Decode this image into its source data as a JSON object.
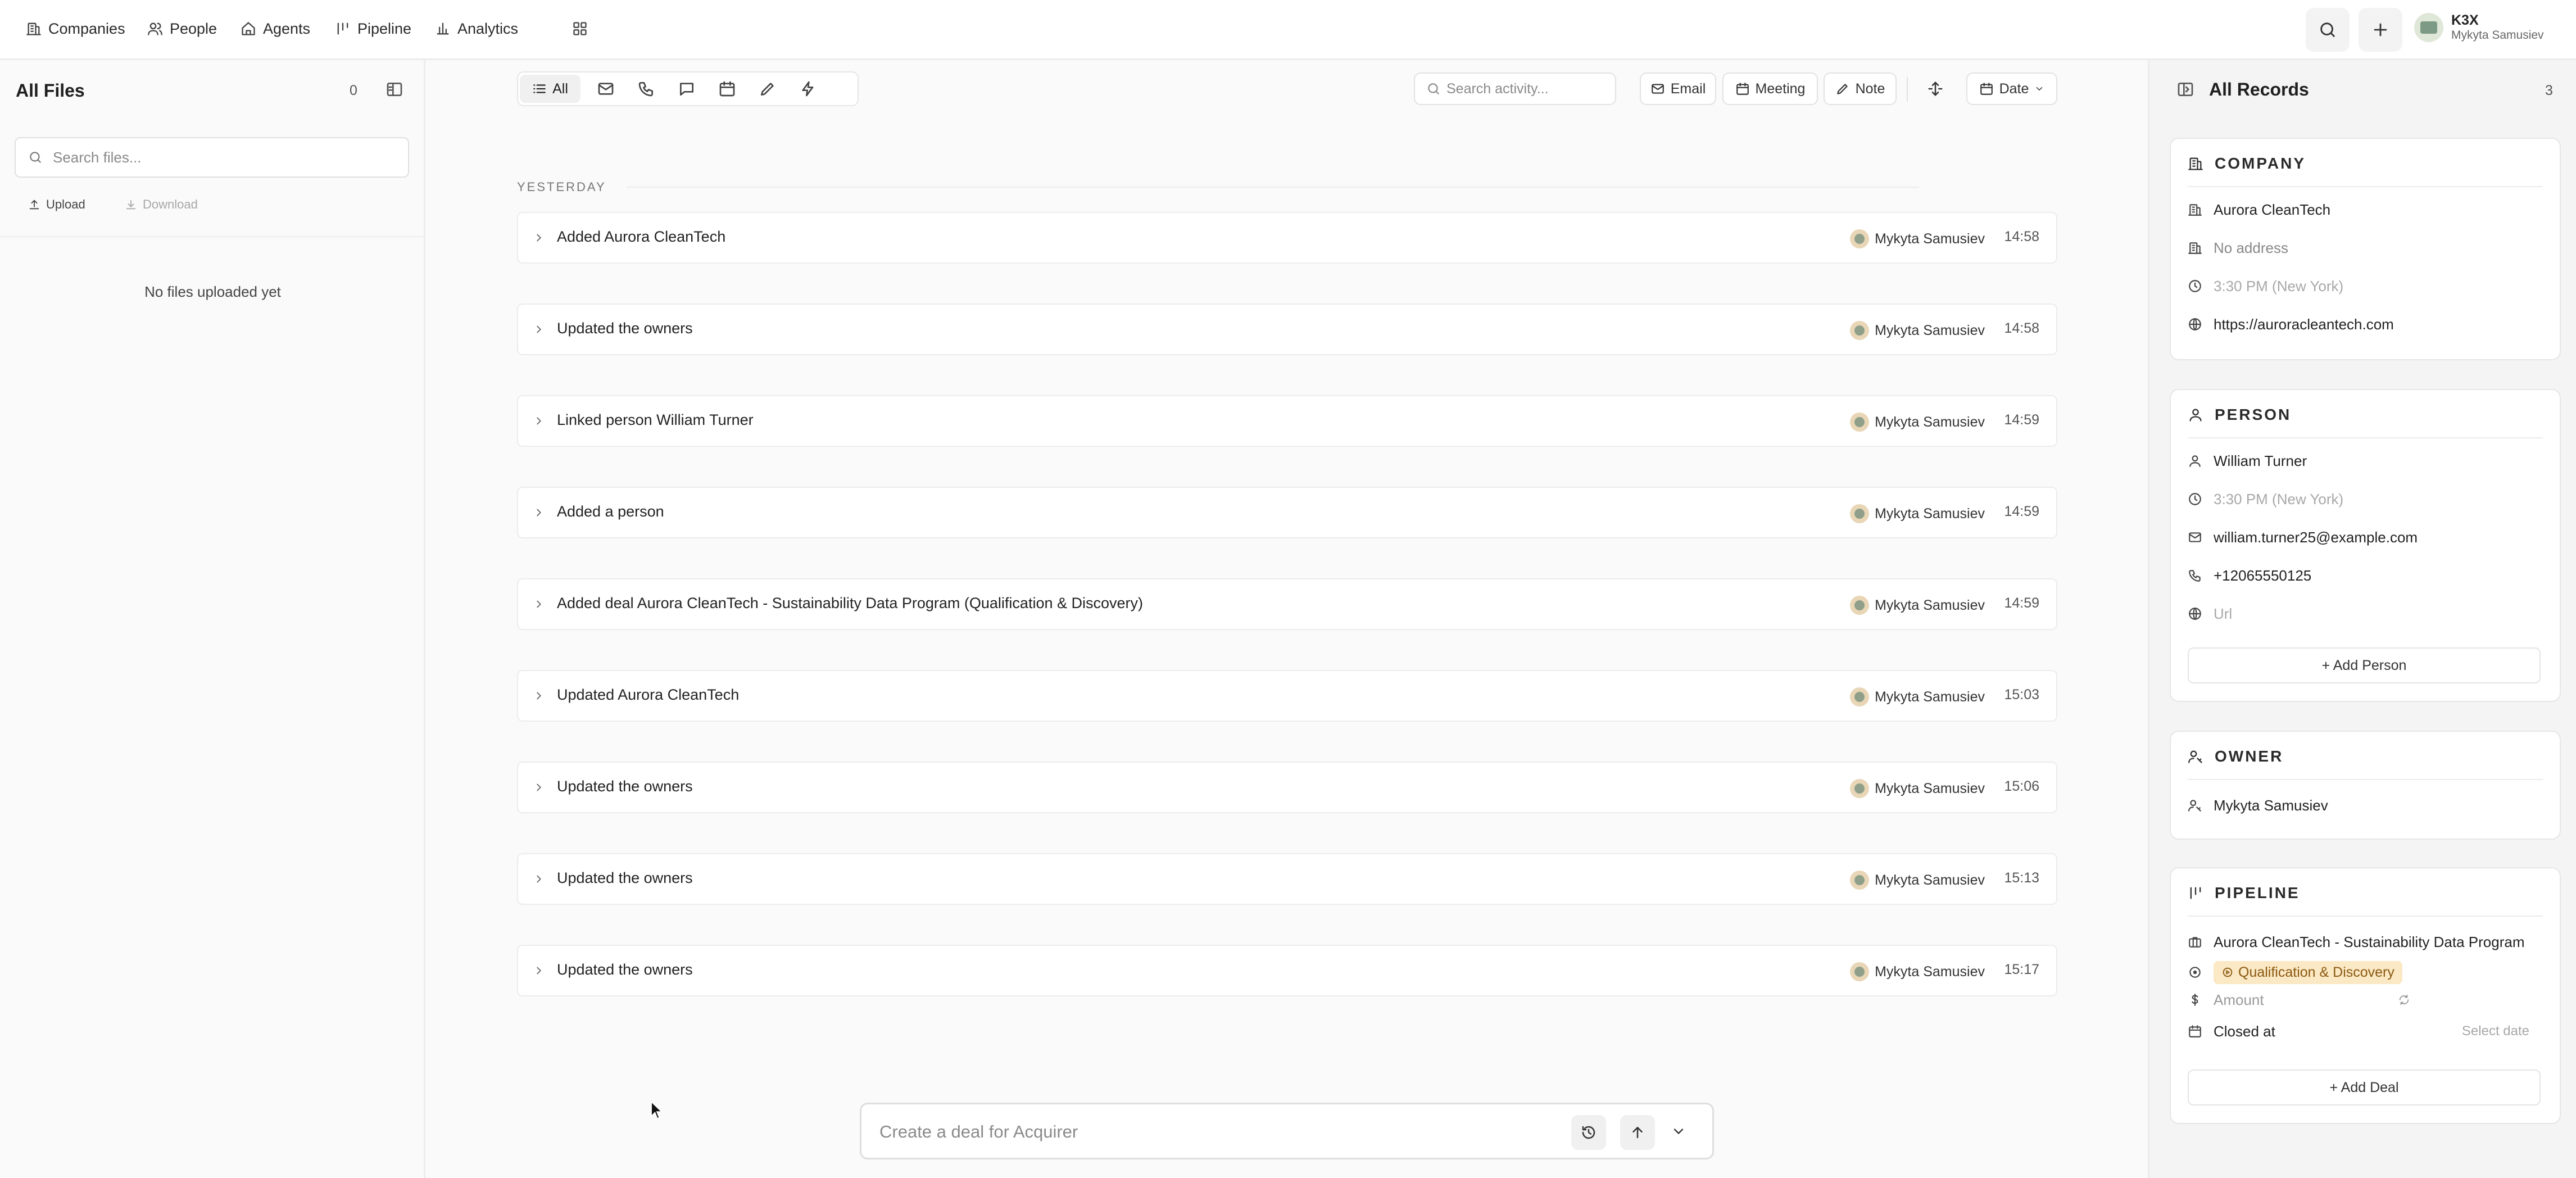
{
  "topbar": {
    "nav": [
      {
        "label": "Companies",
        "icon": "building-icon"
      },
      {
        "label": "People",
        "icon": "people-icon"
      },
      {
        "label": "Agents",
        "icon": "agents-icon"
      },
      {
        "label": "Pipeline",
        "icon": "pipeline-icon"
      },
      {
        "label": "Analytics",
        "icon": "bar-chart-icon"
      }
    ],
    "user": {
      "name": "K3X",
      "sub": "Mykyta Samusiev"
    }
  },
  "files_panel": {
    "title": "All Files",
    "count": "0",
    "search_placeholder": "Search files...",
    "upload_label": "Upload",
    "download_label": "Download",
    "empty_text": "No files uploaded yet"
  },
  "activity": {
    "filters": {
      "all_label": "All"
    },
    "search_placeholder": "Search activity...",
    "actions": {
      "email": "Email",
      "meeting": "Meeting",
      "note": "Note",
      "date": "Date"
    },
    "group_label": "YESTERDAY",
    "items": [
      {
        "title": "Added Aurora CleanTech",
        "user": "Mykyta Samusiev",
        "time": "14:58"
      },
      {
        "title": "Updated the owners",
        "user": "Mykyta Samusiev",
        "time": "14:58"
      },
      {
        "title": "Linked person William Turner",
        "user": "Mykyta Samusiev",
        "time": "14:59"
      },
      {
        "title": "Added a person",
        "user": "Mykyta Samusiev",
        "time": "14:59"
      },
      {
        "title": "Added deal Aurora CleanTech - Sustainability Data Program (Qualification & Discovery)",
        "user": "Mykyta Samusiev",
        "time": "14:59"
      },
      {
        "title": "Updated Aurora CleanTech",
        "user": "Mykyta Samusiev",
        "time": "15:03"
      },
      {
        "title": "Updated the owners",
        "user": "Mykyta Samusiev",
        "time": "15:06"
      },
      {
        "title": "Updated the owners",
        "user": "Mykyta Samusiev",
        "time": "15:13"
      },
      {
        "title": "Updated the owners",
        "user": "Mykyta Samusiev",
        "time": "15:17"
      }
    ]
  },
  "composer": {
    "placeholder": "Create a deal for Acquirer"
  },
  "records": {
    "title": "All Records",
    "count": "3",
    "company": {
      "heading": "COMPANY",
      "name": "Aurora CleanTech",
      "address": "No address",
      "local_time": "3:30 PM (New York)",
      "website": "https://auroracleantech.com"
    },
    "person": {
      "heading": "PERSON",
      "name": "William Turner",
      "local_time": "3:30 PM (New York)",
      "email": "william.turner25@example.com",
      "phone": "+12065550125",
      "url_placeholder": "Url",
      "add_label": "+ Add Person"
    },
    "owner": {
      "heading": "OWNER",
      "name": "Mykyta Samusiev"
    },
    "pipeline": {
      "heading": "PIPELINE",
      "deal_name": "Aurora CleanTech - Sustainability Data Program",
      "stage": "Qualification & Discovery",
      "amount_label": "Amount",
      "closed_at_label": "Closed at",
      "select_date": "Select date",
      "add_label": "+ Add Deal"
    }
  },
  "colors": {
    "stage_tag_bg": "#fbe8c4",
    "stage_tag_text": "#8a5a12",
    "muted_text": "#a8a8a8",
    "panel_bg": "#fafafa"
  }
}
